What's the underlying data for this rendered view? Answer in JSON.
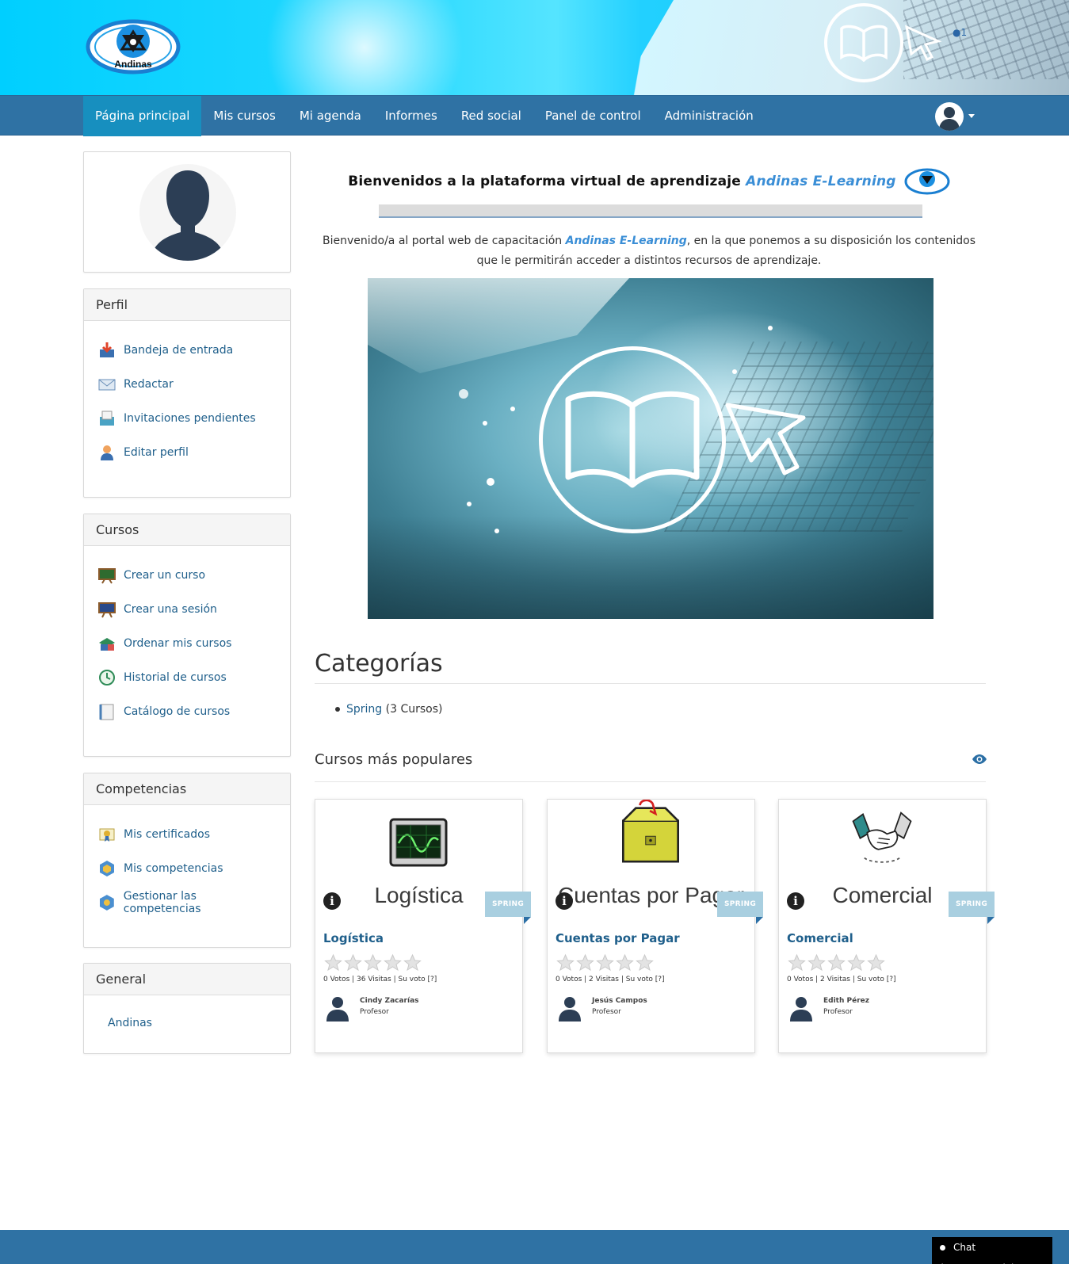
{
  "header": {
    "logo_text": "Andinas",
    "banner_user_badge": "1"
  },
  "nav": {
    "items": [
      {
        "label": "Página principal",
        "active": true
      },
      {
        "label": "Mis cursos"
      },
      {
        "label": "Mi agenda"
      },
      {
        "label": "Informes"
      },
      {
        "label": "Red social"
      },
      {
        "label": "Panel de control"
      },
      {
        "label": "Administración"
      }
    ],
    "user_menu_icon": "user-avatar-icon"
  },
  "sidebar": {
    "profile": {
      "title": "Perfil",
      "items": [
        {
          "label": "Bandeja de entrada",
          "icon": "inbox-icon"
        },
        {
          "label": "Redactar",
          "icon": "envelope-icon"
        },
        {
          "label": "Invitaciones pendientes",
          "icon": "invitation-icon"
        },
        {
          "label": "Editar perfil",
          "icon": "edit-profile-icon"
        }
      ]
    },
    "courses": {
      "title": "Cursos",
      "items": [
        {
          "label": "Crear un curso",
          "icon": "create-course-icon"
        },
        {
          "label": "Crear una sesión",
          "icon": "create-session-icon"
        },
        {
          "label": "Ordenar mis cursos",
          "icon": "sort-courses-icon"
        },
        {
          "label": "Historial de cursos",
          "icon": "history-icon"
        },
        {
          "label": "Catálogo de cursos",
          "icon": "catalog-icon"
        }
      ]
    },
    "skills": {
      "title": "Competencias",
      "items": [
        {
          "label": "Mis certificados",
          "icon": "certificate-icon"
        },
        {
          "label": "Mis competencias",
          "icon": "skills-icon"
        },
        {
          "label": "Gestionar las competencias",
          "icon": "manage-skills-icon"
        }
      ]
    },
    "general": {
      "title": "General",
      "items": [
        {
          "label": "Andinas"
        }
      ]
    }
  },
  "main": {
    "welcome_prefix": "Bienvenidos a la plataforma virtual de aprendizaje ",
    "welcome_brand": "Andinas E-Learning",
    "intro_prefix": "Bienvenido/a al portal web de capacitación ",
    "intro_brand": "Andinas E-Learning",
    "intro_suffix": ", en la que ponemos a su disposición los contenidos que le permitirán acceder a distintos recursos de aprendizaje.",
    "categories_title": "Categorías",
    "category": {
      "name": "Spring",
      "count": "(3 Cursos)"
    },
    "popular_title": "Cursos más populares",
    "courses": [
      {
        "thumb_label": "Logística",
        "title": "Logística",
        "ribbon": "SPRING",
        "votes": "0 Votos | 36 Visitas | Su voto [?]",
        "teacher": "Cindy Zacarías",
        "role": "Profesor",
        "icon": "monitor-icon"
      },
      {
        "thumb_label": "Cuentas por Pagar",
        "title": "Cuentas por Pagar",
        "ribbon": "SPRING",
        "votes": "0 Votos | 2 Visitas | Su voto [?]",
        "teacher": "Jesús Campos",
        "role": "Profesor",
        "icon": "cashbox-icon"
      },
      {
        "thumb_label": "Comercial",
        "title": "Comercial",
        "ribbon": "SPRING",
        "votes": "0 Votos | 2 Visitas | Su voto [?]",
        "teacher": "Edith Pérez",
        "role": "Profesor",
        "icon": "handshake-icon"
      }
    ]
  },
  "footer": {
    "chat_label": "Chat (Desconectado)"
  },
  "colors": {
    "nav": "#2f72a4",
    "nav_active": "#178fbf",
    "link": "#1f5f8b",
    "brand": "#3a8ed6"
  }
}
